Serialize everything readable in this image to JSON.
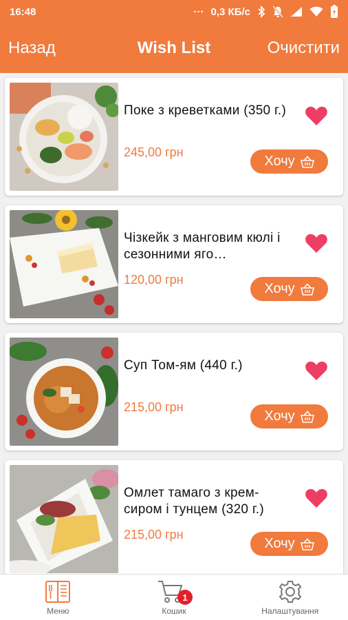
{
  "status_bar": {
    "time": "16:48",
    "more": "···",
    "speed": "0,3 КБ/с"
  },
  "header": {
    "back_label": "Назад",
    "title": "Wish List",
    "clear_label": "Очистити"
  },
  "colors": {
    "accent": "#f17a3d",
    "heart": "#ee3e63",
    "badge": "#e2202a"
  },
  "items": [
    {
      "name": "Поке з креветками (350 г.)",
      "price": "245,00 грн",
      "button_label": "Хочу",
      "favorited": true,
      "image": "poke-bowl"
    },
    {
      "name": "Чізкейк з манговим кюлі і сезонними яго…",
      "price": "120,00 грн",
      "button_label": "Хочу",
      "favorited": true,
      "image": "cheesecake"
    },
    {
      "name": "Суп Том-ям (440 г.)",
      "price": "215,00 грн",
      "button_label": "Хочу",
      "favorited": true,
      "image": "tom-yum"
    },
    {
      "name": "Омлет тамаго з крем-сиром і тунцем (320 г.)",
      "price": "215,00 грн",
      "button_label": "Хочу",
      "favorited": true,
      "image": "tamago"
    }
  ],
  "tabbar": {
    "tabs": [
      {
        "label": "Меню",
        "icon": "menu-book-icon"
      },
      {
        "label": "Кошик",
        "icon": "cart-icon",
        "badge": "1"
      },
      {
        "label": "Налаштування",
        "icon": "gear-icon"
      }
    ]
  }
}
